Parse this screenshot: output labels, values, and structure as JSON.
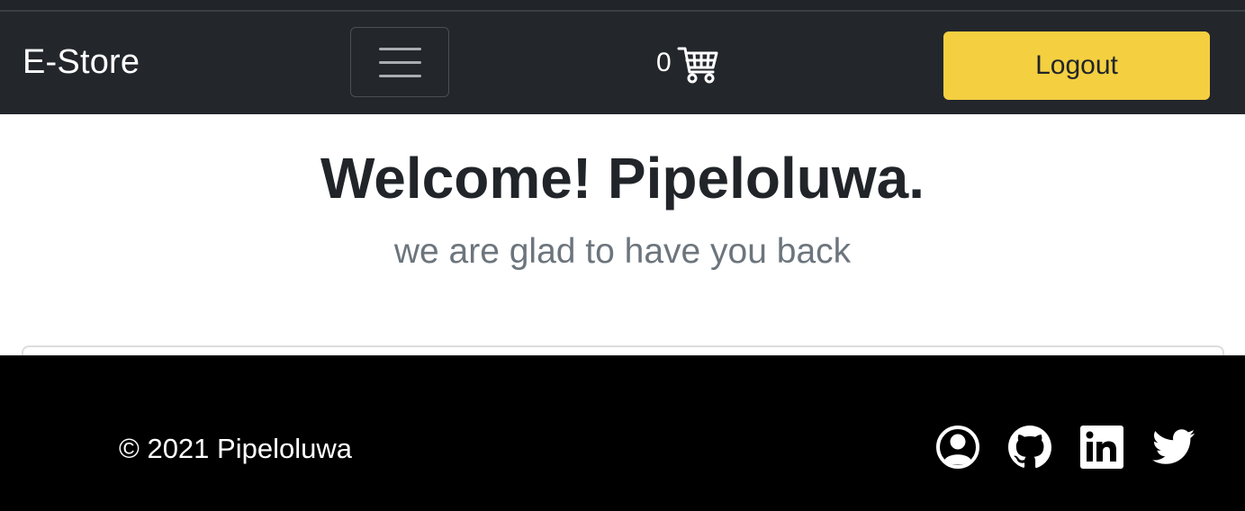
{
  "navbar": {
    "brand": "E-Store",
    "toggler_icon": "hamburger-menu-icon",
    "cart_count": "0",
    "cart_icon": "shopping-cart-icon",
    "logout_label": "Logout"
  },
  "hero": {
    "title": "Welcome! Pipeloluwa.",
    "subtitle": "we are glad to have you back"
  },
  "footer": {
    "copyright": "© 2021 Pipeloluwa",
    "social": [
      {
        "icon": "user-circle-icon"
      },
      {
        "icon": "github-icon"
      },
      {
        "icon": "linkedin-icon"
      },
      {
        "icon": "twitter-icon"
      }
    ]
  },
  "colors": {
    "navbar_bg": "#23262b",
    "accent_yellow": "#f4cf40",
    "footer_bg": "#000000",
    "title_text": "#212529",
    "subtitle_text": "#6c757d"
  }
}
